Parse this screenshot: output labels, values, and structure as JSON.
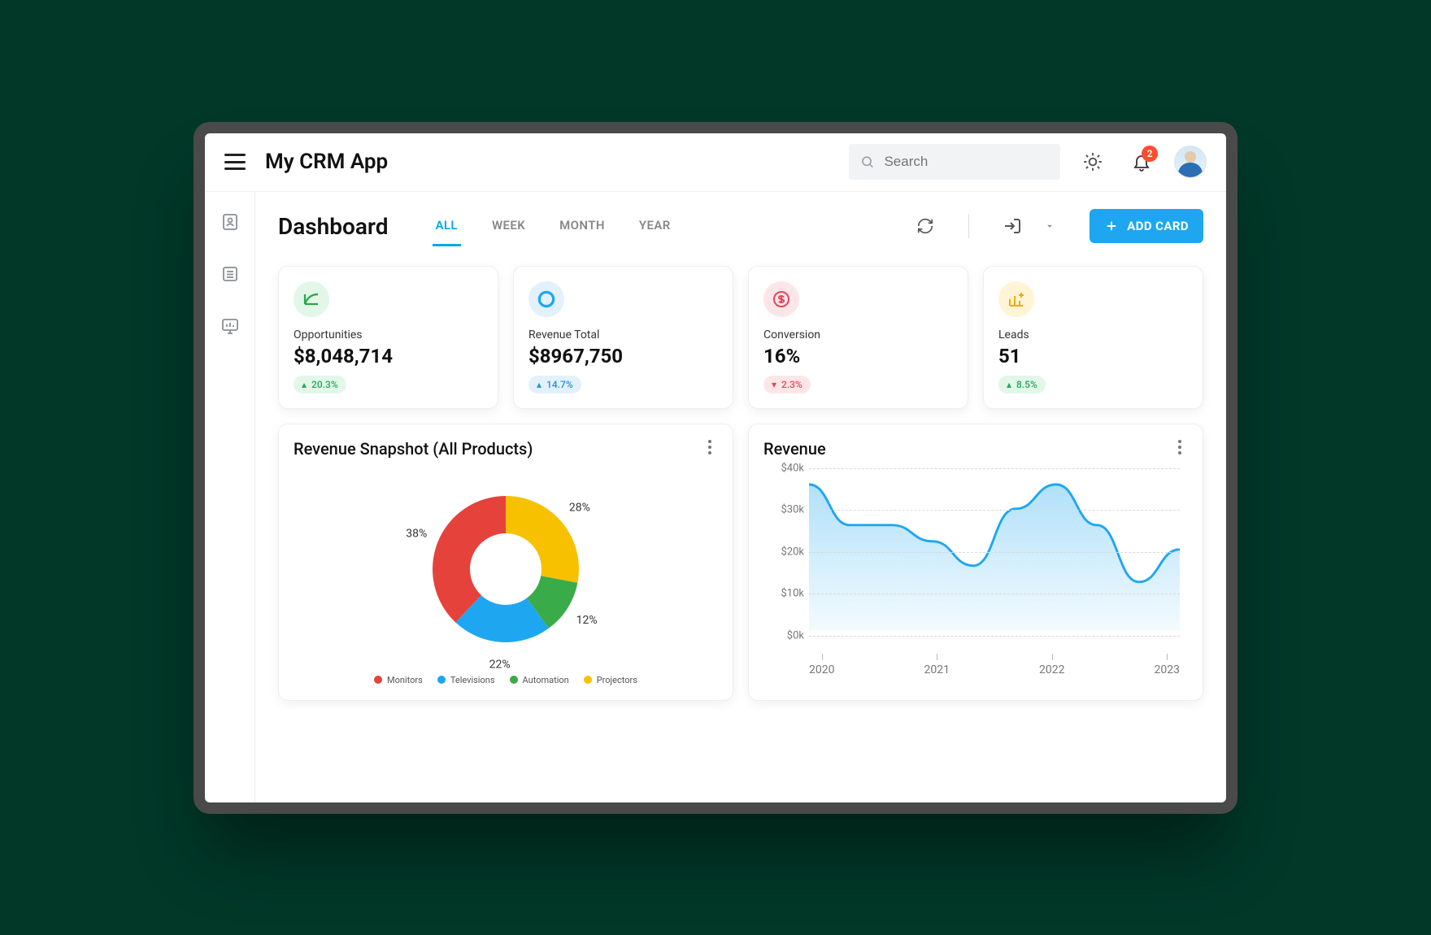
{
  "header": {
    "app_title": "My CRM App",
    "search_placeholder": "Search",
    "notification_count": "2"
  },
  "page": {
    "title": "Dashboard",
    "tabs": [
      "ALL",
      "WEEK",
      "MONTH",
      "YEAR"
    ],
    "active_tab": 0,
    "add_card_label": "ADD CARD"
  },
  "kpis": [
    {
      "label": "Opportunities",
      "value": "$8,048,714",
      "delta": "20.3%",
      "delta_dir": "up",
      "chip": "green",
      "icon_bg": "#e2f7e8",
      "icon": "line-up",
      "icon_color": "#28a745"
    },
    {
      "label": "Revenue Total",
      "value": "$8967,750",
      "delta": "14.7%",
      "delta_dir": "up",
      "chip": "blue",
      "icon_bg": "#e2f1fc",
      "icon": "donut",
      "icon_color": "#1ea7f0"
    },
    {
      "label": "Conversion",
      "value": "16%",
      "delta": "2.3%",
      "delta_dir": "down",
      "chip": "red",
      "icon_bg": "#fde6e8",
      "icon": "dollar",
      "icon_color": "#e4475b"
    },
    {
      "label": "Leads",
      "value": "51",
      "delta": "8.5%",
      "delta_dir": "up",
      "chip": "green",
      "icon_bg": "#fff5d6",
      "icon": "bar-plus",
      "icon_color": "#f2a900"
    }
  ],
  "panels": {
    "snapshot": {
      "title": "Revenue Snapshot (All Products)",
      "legend": [
        {
          "name": "Monitors",
          "color": "#e6423c"
        },
        {
          "name": "Televisions",
          "color": "#1ea7f0"
        },
        {
          "name": "Automation",
          "color": "#3aab49"
        },
        {
          "name": "Projectors",
          "color": "#f7c100"
        }
      ]
    },
    "revenue": {
      "title": "Revenue",
      "y_ticks": [
        "$40k",
        "$30k",
        "$20k",
        "$10k",
        "$0k"
      ],
      "x_ticks": [
        "2020",
        "2021",
        "2022",
        "2023"
      ]
    }
  },
  "chart_data": [
    {
      "type": "pie",
      "title": "Revenue Snapshot (All Products)",
      "series": [
        {
          "name": "Monitors",
          "value": 38,
          "color": "#e6423c"
        },
        {
          "name": "Projectors",
          "value": 28,
          "color": "#f7c100"
        },
        {
          "name": "Automation",
          "value": 12,
          "color": "#3aab49"
        },
        {
          "name": "Televisions",
          "value": 22,
          "color": "#1ea7f0"
        }
      ],
      "display_labels": [
        "38%",
        "28%",
        "12%",
        "22%"
      ]
    },
    {
      "type": "area",
      "title": "Revenue",
      "x": [
        2020,
        2020.33,
        2020.67,
        2021,
        2021.33,
        2021.67,
        2022,
        2022.33,
        2022.67,
        2023
      ],
      "y": [
        36,
        26,
        26,
        22,
        16,
        30,
        36,
        26,
        12,
        20
      ],
      "xlabel": "",
      "ylabel": "",
      "ylim": [
        0,
        40
      ],
      "y_unit": "$k",
      "color": "#1ea7f0"
    }
  ],
  "colors": {
    "accent": "#1ea7f0"
  }
}
